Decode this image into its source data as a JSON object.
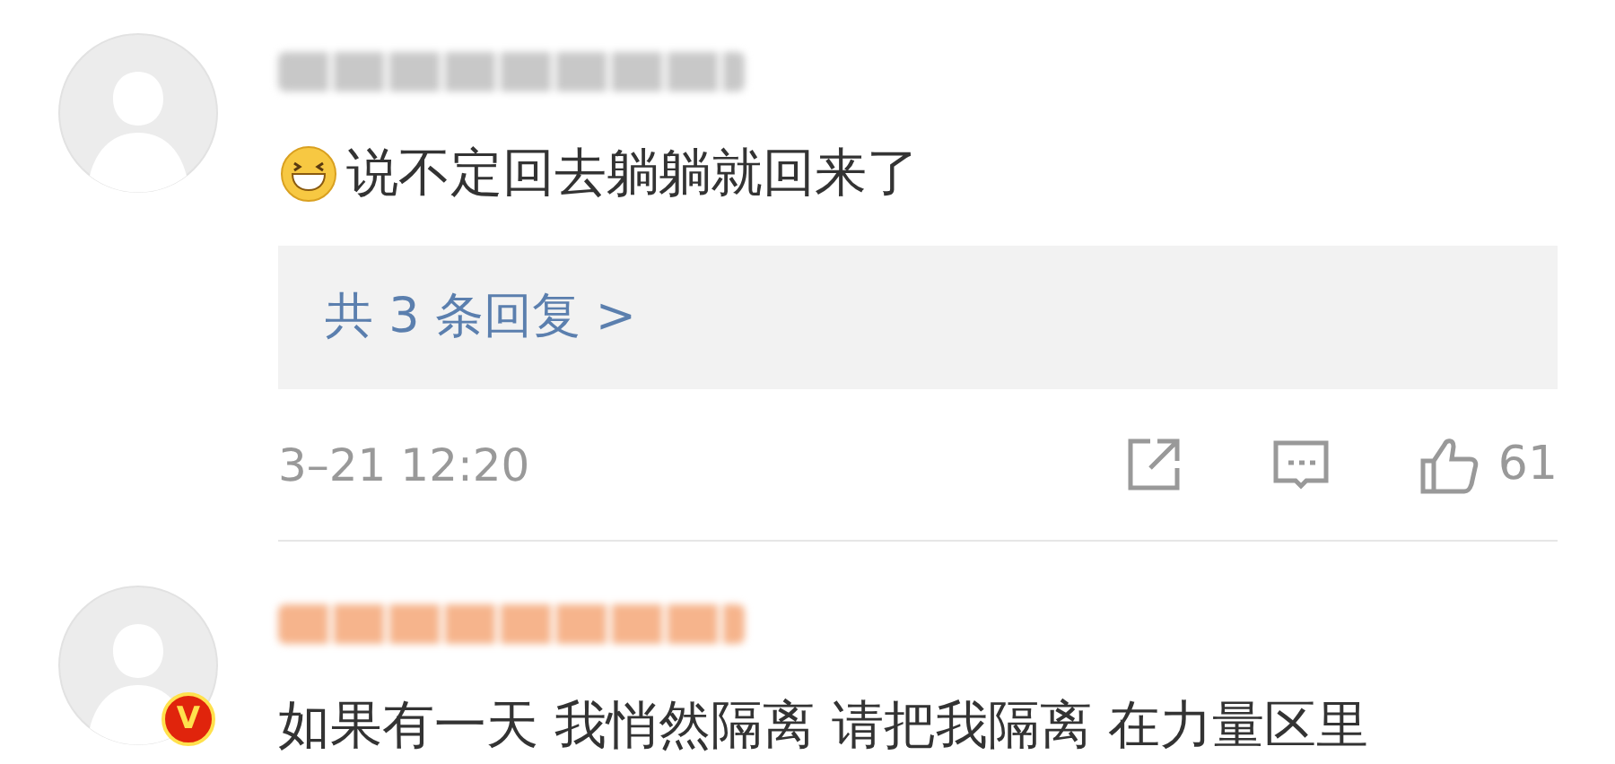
{
  "comments": [
    {
      "user": {
        "color": "#c8c8c8"
      },
      "emoji": true,
      "text": "说不定回去躺躺就回来了",
      "replies": "共 3 条回复 >",
      "time": "3–21 12:20",
      "likes": "61"
    },
    {
      "user": {
        "color": "#f6b48c",
        "badge": "V"
      },
      "text": "如果有一天 我悄然隔离 请把我隔离 在力量区里"
    }
  ]
}
